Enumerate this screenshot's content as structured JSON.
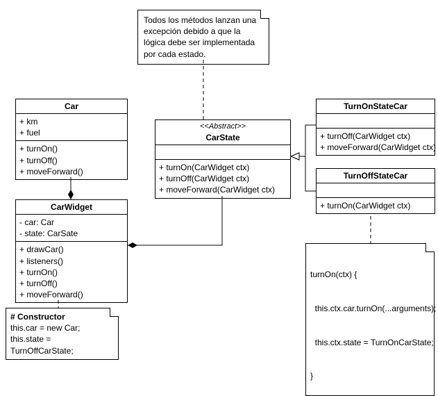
{
  "note_top": {
    "text": "Todos los métodos lanzan una excepción debido a que la lógica debe ser implementada por cada estado."
  },
  "car": {
    "name": "Car",
    "attrs": [
      "+ km",
      "+ fuel"
    ],
    "ops": [
      "+ turnOn()",
      "+ turnOff()",
      "+ moveForward()"
    ]
  },
  "car_widget": {
    "name": "CarWidget",
    "attrs": [
      "- car: Car",
      "- state: CarSate"
    ],
    "ops": [
      "+ drawCar()",
      "+ listeners()",
      "+ turnOn()",
      "+ turnOff()",
      "+ moveForward()"
    ]
  },
  "car_state": {
    "stereotype": "<<Abstract>>",
    "name": "CarState",
    "ops": [
      "+ turnOn(CarWidget ctx)",
      "+ turnOff(CarWidget ctx)",
      "+ moveForward(CarWidget ctx)"
    ]
  },
  "turn_on": {
    "name": "TurnOnStateCar",
    "ops": [
      "+ turnOff(CarWidget ctx)",
      "+ moveForward(CarWidget ctx)"
    ]
  },
  "turn_off": {
    "name": "TurnOffStateCar",
    "ops": [
      "+ turnOn(CarWidget ctx)"
    ]
  },
  "note_constructor": {
    "title": "# Constructor",
    "l1": "this.car = new Car;",
    "l2": "this.state = TurnOffCarState;"
  },
  "note_turnon": {
    "l1": "turnOn(ctx) {",
    "l2": "  this.ctx.car.turnOn(...arguments);",
    "l3": "  this.ctx.state = TurnOnCarState;",
    "l4": "}"
  },
  "chart_data": {
    "type": "uml_class_diagram",
    "classes": [
      {
        "name": "Car",
        "attributes": [
          "+ km",
          "+ fuel"
        ],
        "operations": [
          "+ turnOn()",
          "+ turnOff()",
          "+ moveForward()"
        ]
      },
      {
        "name": "CarWidget",
        "attributes": [
          "- car: Car",
          "- state: CarSate"
        ],
        "operations": [
          "+ drawCar()",
          "+ listeners()",
          "+ turnOn()",
          "+ turnOff()",
          "+ moveForward()"
        ]
      },
      {
        "name": "CarState",
        "stereotype": "Abstract",
        "operations": [
          "+ turnOn(CarWidget ctx)",
          "+ turnOff(CarWidget ctx)",
          "+ moveForward(CarWidget ctx)"
        ]
      },
      {
        "name": "TurnOnStateCar",
        "operations": [
          "+ turnOff(CarWidget ctx)",
          "+ moveForward(CarWidget ctx)"
        ]
      },
      {
        "name": "TurnOffStateCar",
        "operations": [
          "+ turnOn(CarWidget ctx)"
        ]
      }
    ],
    "relations": [
      {
        "from": "CarWidget",
        "to": "Car",
        "type": "composition"
      },
      {
        "from": "CarWidget",
        "to": "CarState",
        "type": "composition"
      },
      {
        "from": "TurnOnStateCar",
        "to": "CarState",
        "type": "generalization"
      },
      {
        "from": "TurnOffStateCar",
        "to": "CarState",
        "type": "generalization"
      }
    ],
    "notes": [
      {
        "attached_to": "CarState",
        "text": "Todos los métodos lanzan una excepción debido a que la lógica debe ser implementada por cada estado."
      },
      {
        "attached_to": "CarWidget",
        "text": "# Constructor\nthis.car = new Car;\nthis.state = TurnOffCarState;"
      },
      {
        "attached_to": "TurnOffStateCar",
        "text": "turnOn(ctx) {\n  this.ctx.car.turnOn(...arguments);\n  this.ctx.state = TurnOnCarState;\n}"
      }
    ]
  }
}
